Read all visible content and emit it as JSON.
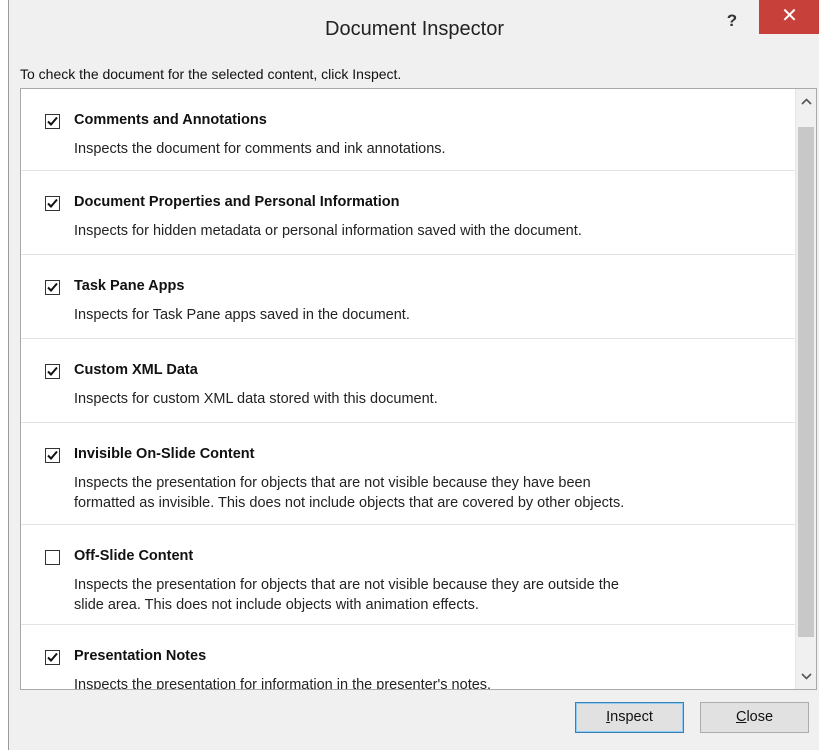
{
  "window": {
    "title": "Document Inspector",
    "help_label": "?",
    "close_label": "✕"
  },
  "intro_text": "To check the document for the selected content, click Inspect.",
  "items": [
    {
      "checked": true,
      "title": "Comments and Annotations",
      "desc_lines": [
        "Inspects the document for comments and ink annotations."
      ]
    },
    {
      "checked": true,
      "title": "Document Properties and Personal Information",
      "desc_lines": [
        "Inspects for hidden metadata or personal information saved with the document."
      ]
    },
    {
      "checked": true,
      "title": "Task Pane Apps",
      "desc_lines": [
        "Inspects for Task Pane apps saved in the document."
      ]
    },
    {
      "checked": true,
      "title": "Custom XML Data",
      "desc_lines": [
        "Inspects for custom XML data stored with this document."
      ]
    },
    {
      "checked": true,
      "title": "Invisible On-Slide Content",
      "desc_lines": [
        "Inspects the presentation for objects that are not visible because they have been",
        "formatted as invisible. This does not include objects that are covered by other objects."
      ]
    },
    {
      "checked": false,
      "title": "Off-Slide Content",
      "desc_lines": [
        "Inspects the presentation for objects that are not visible because they are outside the",
        "slide area.  This does not include objects with animation effects."
      ]
    },
    {
      "checked": true,
      "title": "Presentation Notes",
      "desc_lines": [
        "Inspects the presentation for information in the presenter's notes."
      ]
    }
  ],
  "buttons": {
    "inspect_access": "I",
    "inspect_rest": "nspect",
    "close_access": "C",
    "close_rest": "lose"
  },
  "icons": {
    "scroll_up": "chevron-up-icon",
    "scroll_down": "chevron-down-icon",
    "check": "checkmark-icon"
  }
}
